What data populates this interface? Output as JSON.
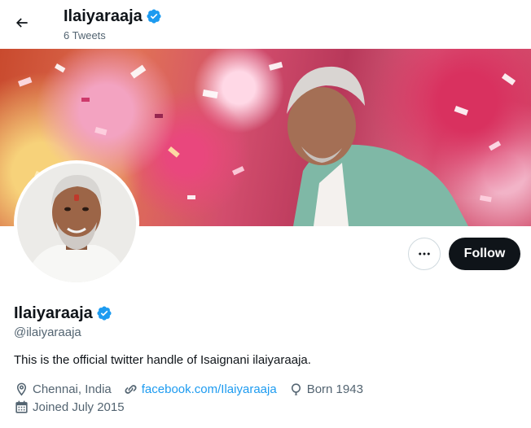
{
  "header": {
    "title": "Ilaiyaraaja",
    "tweet_count": "6 Tweets"
  },
  "profile": {
    "name": "Ilaiyaraaja",
    "handle": "@ilaiyaraaja",
    "bio": "This is the official twitter handle of Isaignani ilaiyaraaja.",
    "location": "Chennai, India",
    "website": "facebook.com/Ilaiyaraaja",
    "born": "Born 1943",
    "joined": "Joined July 2015"
  },
  "actions": {
    "follow_label": "Follow"
  },
  "icons": {
    "back": "arrow-left-icon",
    "verified": "verified-badge-icon",
    "more": "more-horizontal-icon",
    "location": "location-pin-icon",
    "link": "link-icon",
    "birthday": "balloon-icon",
    "calendar": "calendar-icon"
  },
  "colors": {
    "verified": "#1d9bf0",
    "link": "#1d9bf0",
    "follow_bg": "#0f1419",
    "secondary_text": "#536471"
  }
}
